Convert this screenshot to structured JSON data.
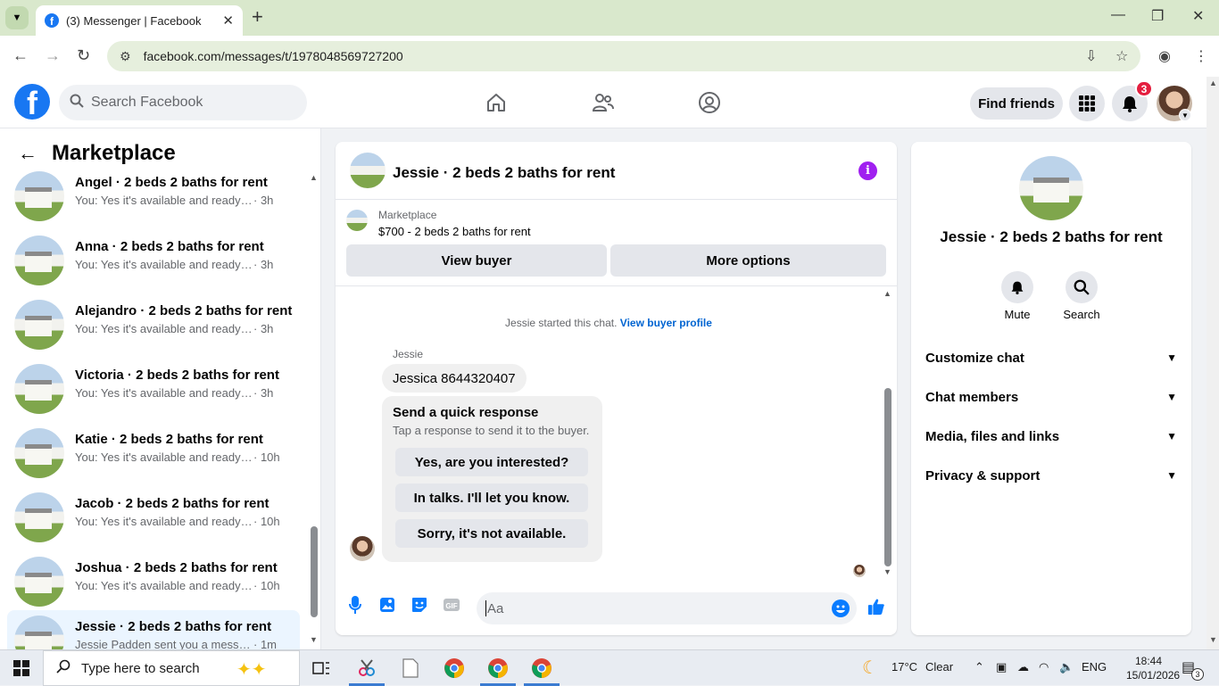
{
  "browser": {
    "tab_title": "(3) Messenger | Facebook",
    "url": "facebook.com/messages/t/1978048569727200",
    "new_tab": "+",
    "tab_close": "✕"
  },
  "fb": {
    "search_placeholder": "Search Facebook",
    "find_friends": "Find friends",
    "notification_count": "3",
    "brand_color": "#1877f2"
  },
  "sidebar": {
    "title": "Marketplace",
    "conversations": [
      {
        "name": "Angel · 2 beds 2 baths for rent",
        "preview": "You: Yes it's available and ready to ...",
        "time": "· 3h"
      },
      {
        "name": "Anna · 2 beds 2 baths for rent",
        "preview": "You: Yes it's available and ready to ...",
        "time": "· 3h"
      },
      {
        "name": "Alejandro · 2 beds 2 baths for rent",
        "preview": "You: Yes it's available and ready to ...",
        "time": "· 3h"
      },
      {
        "name": "Victoria · 2 beds 2 baths for rent",
        "preview": "You: Yes it's available and ready to ...",
        "time": "· 3h"
      },
      {
        "name": "Katie · 2 beds 2 baths for rent",
        "preview": "You: Yes it's available and ready to...",
        "time": "· 10h"
      },
      {
        "name": "Jacob · 2 beds 2 baths for rent",
        "preview": "You: Yes it's available and ready to...",
        "time": "· 10h"
      },
      {
        "name": "Joshua · 2 beds 2 baths for rent",
        "preview": "You: Yes it's available and ready to...",
        "time": "· 10h"
      },
      {
        "name": "Jessie · 2 beds 2 baths for rent",
        "preview": "Jessie Padden sent you a message",
        "time": "· 1m"
      }
    ]
  },
  "chat": {
    "title": "Jessie · 2 beds 2 baths for rent",
    "marketplace_label": "Marketplace",
    "listing": "$700 - 2 beds 2 baths for rent",
    "view_buyer": "View buyer",
    "more_options": "More options",
    "started_text": "Jessie started this chat.",
    "view_buyer_profile": "View buyer profile",
    "sender": "Jessie",
    "message": "Jessica 8644320407",
    "quick_title": "Send a quick response",
    "quick_sub": "Tap a response to send it to the buyer.",
    "quick_responses": [
      "Yes, are you interested?",
      "In talks. I'll let you know.",
      "Sorry, it's not available."
    ],
    "composer_placeholder": "Aa",
    "info_glyph": "i",
    "gif_label": "GIF"
  },
  "info": {
    "name": "Jessie · 2 beds 2 baths for rent",
    "mute": "Mute",
    "search": "Search",
    "sections": [
      "Customize chat",
      "Chat members",
      "Media, files and links",
      "Privacy & support"
    ]
  },
  "taskbar": {
    "search_placeholder": "Type here to search",
    "weather_temp": "17°C",
    "weather_desc": "Clear",
    "lang": "ENG",
    "time": "18:44",
    "date": "15/01/2026",
    "notif_count": "3"
  }
}
